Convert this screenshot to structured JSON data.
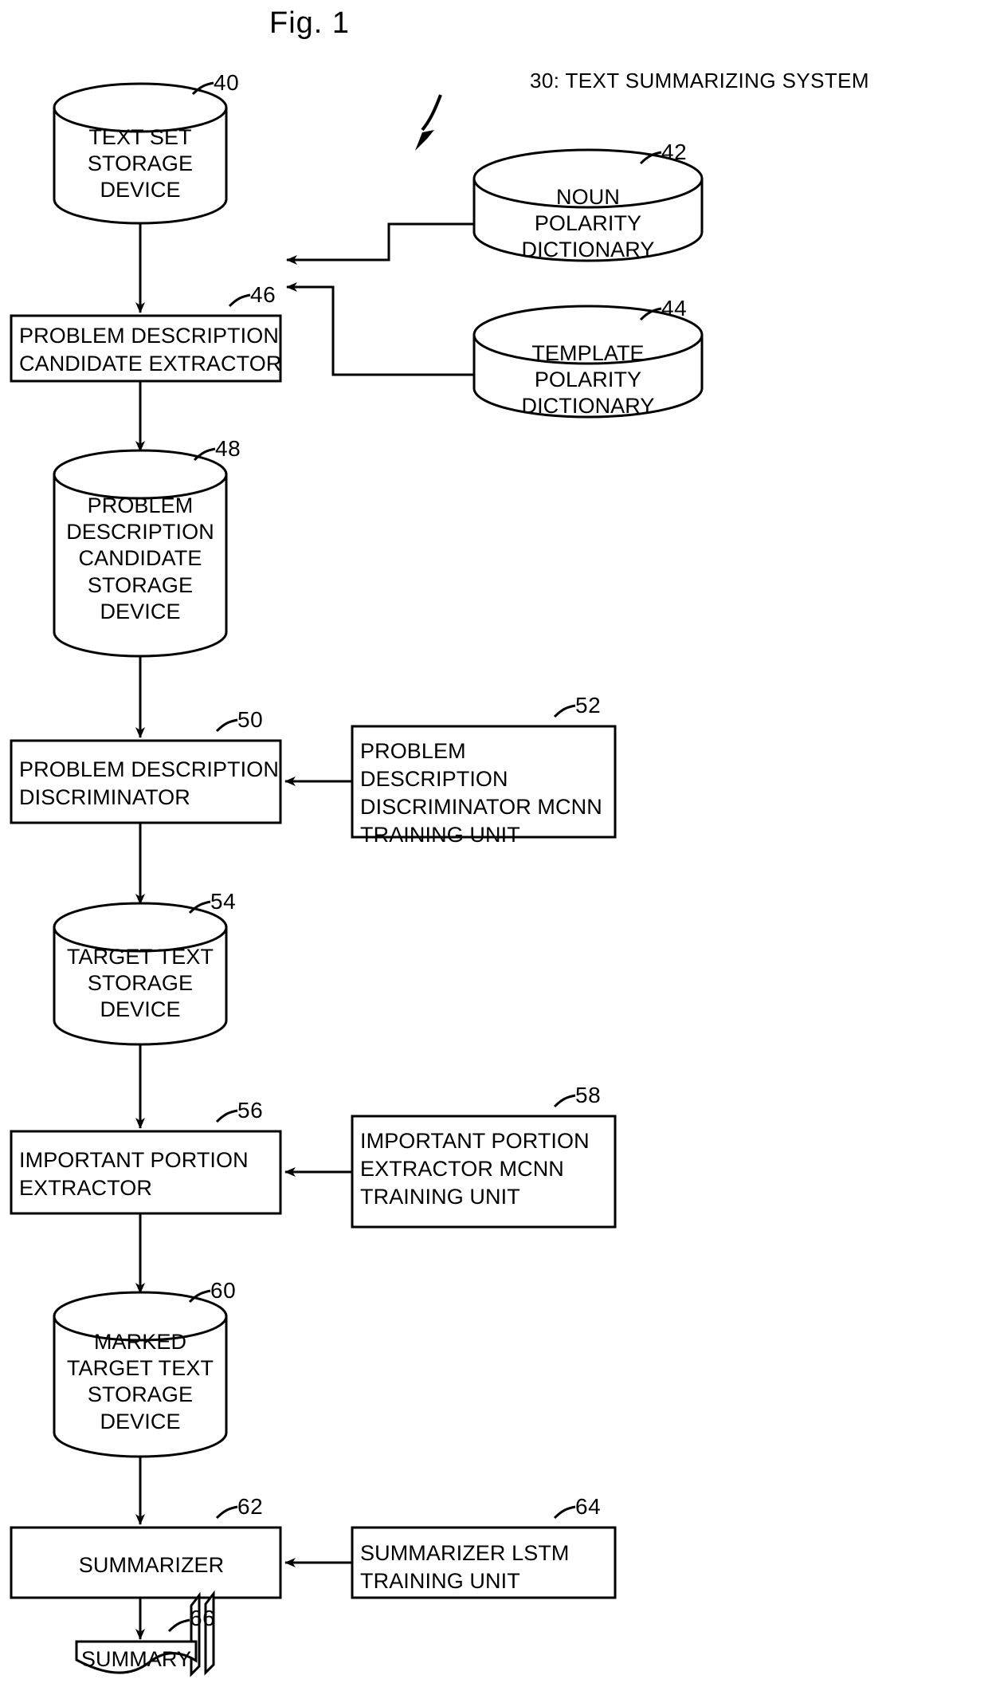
{
  "figure": {
    "title": "Fig. 1",
    "system_label": "30: TEXT SUMMARIZING SYSTEM"
  },
  "nodes": {
    "text_set_storage": {
      "ref": "40",
      "label": "TEXT SET\nSTORAGE\nDEVICE",
      "shape": "cylinder"
    },
    "noun_polarity_dictionary": {
      "ref": "42",
      "label": "NOUN\nPOLARITY\nDICTIONARY",
      "shape": "cylinder"
    },
    "template_polarity_dictionary": {
      "ref": "44",
      "label": "TEMPLATE\nPOLARITY\nDICTIONARY",
      "shape": "cylinder"
    },
    "problem_description_candidate_extractor": {
      "ref": "46",
      "label": "PROBLEM DESCRIPTION\nCANDIDATE EXTRACTOR",
      "shape": "rect"
    },
    "problem_description_candidate_storage": {
      "ref": "48",
      "label": "PROBLEM\nDESCRIPTION\nCANDIDATE\nSTORAGE\nDEVICE",
      "shape": "cylinder"
    },
    "problem_description_discriminator": {
      "ref": "50",
      "label": "PROBLEM DESCRIPTION\nDISCRIMINATOR",
      "shape": "rect"
    },
    "problem_description_discriminator_training": {
      "ref": "52",
      "label": "PROBLEM DESCRIPTION\nDISCRIMINATOR MCNN\nTRAINING UNIT",
      "shape": "rect"
    },
    "target_text_storage": {
      "ref": "54",
      "label": "TARGET TEXT\nSTORAGE\nDEVICE",
      "shape": "cylinder"
    },
    "important_portion_extractor": {
      "ref": "56",
      "label": "IMPORTANT PORTION\nEXTRACTOR",
      "shape": "rect"
    },
    "important_portion_extractor_training": {
      "ref": "58",
      "label": "IMPORTANT PORTION\nEXTRACTOR MCNN\nTRAINING UNIT",
      "shape": "rect"
    },
    "marked_target_text_storage": {
      "ref": "60",
      "label": "MARKED\nTARGET TEXT\nSTORAGE\nDEVICE",
      "shape": "cylinder"
    },
    "summarizer": {
      "ref": "62",
      "label": "SUMMARIZER",
      "shape": "rect"
    },
    "summarizer_training": {
      "ref": "64",
      "label": "SUMMARIZER LSTM\nTRAINING UNIT",
      "shape": "rect"
    },
    "summary_document": {
      "ref": "66",
      "label": "SUMMARY",
      "shape": "document-stack"
    }
  },
  "style": {
    "ink": "#000000",
    "paper": "#ffffff",
    "stroke_width": 3
  }
}
